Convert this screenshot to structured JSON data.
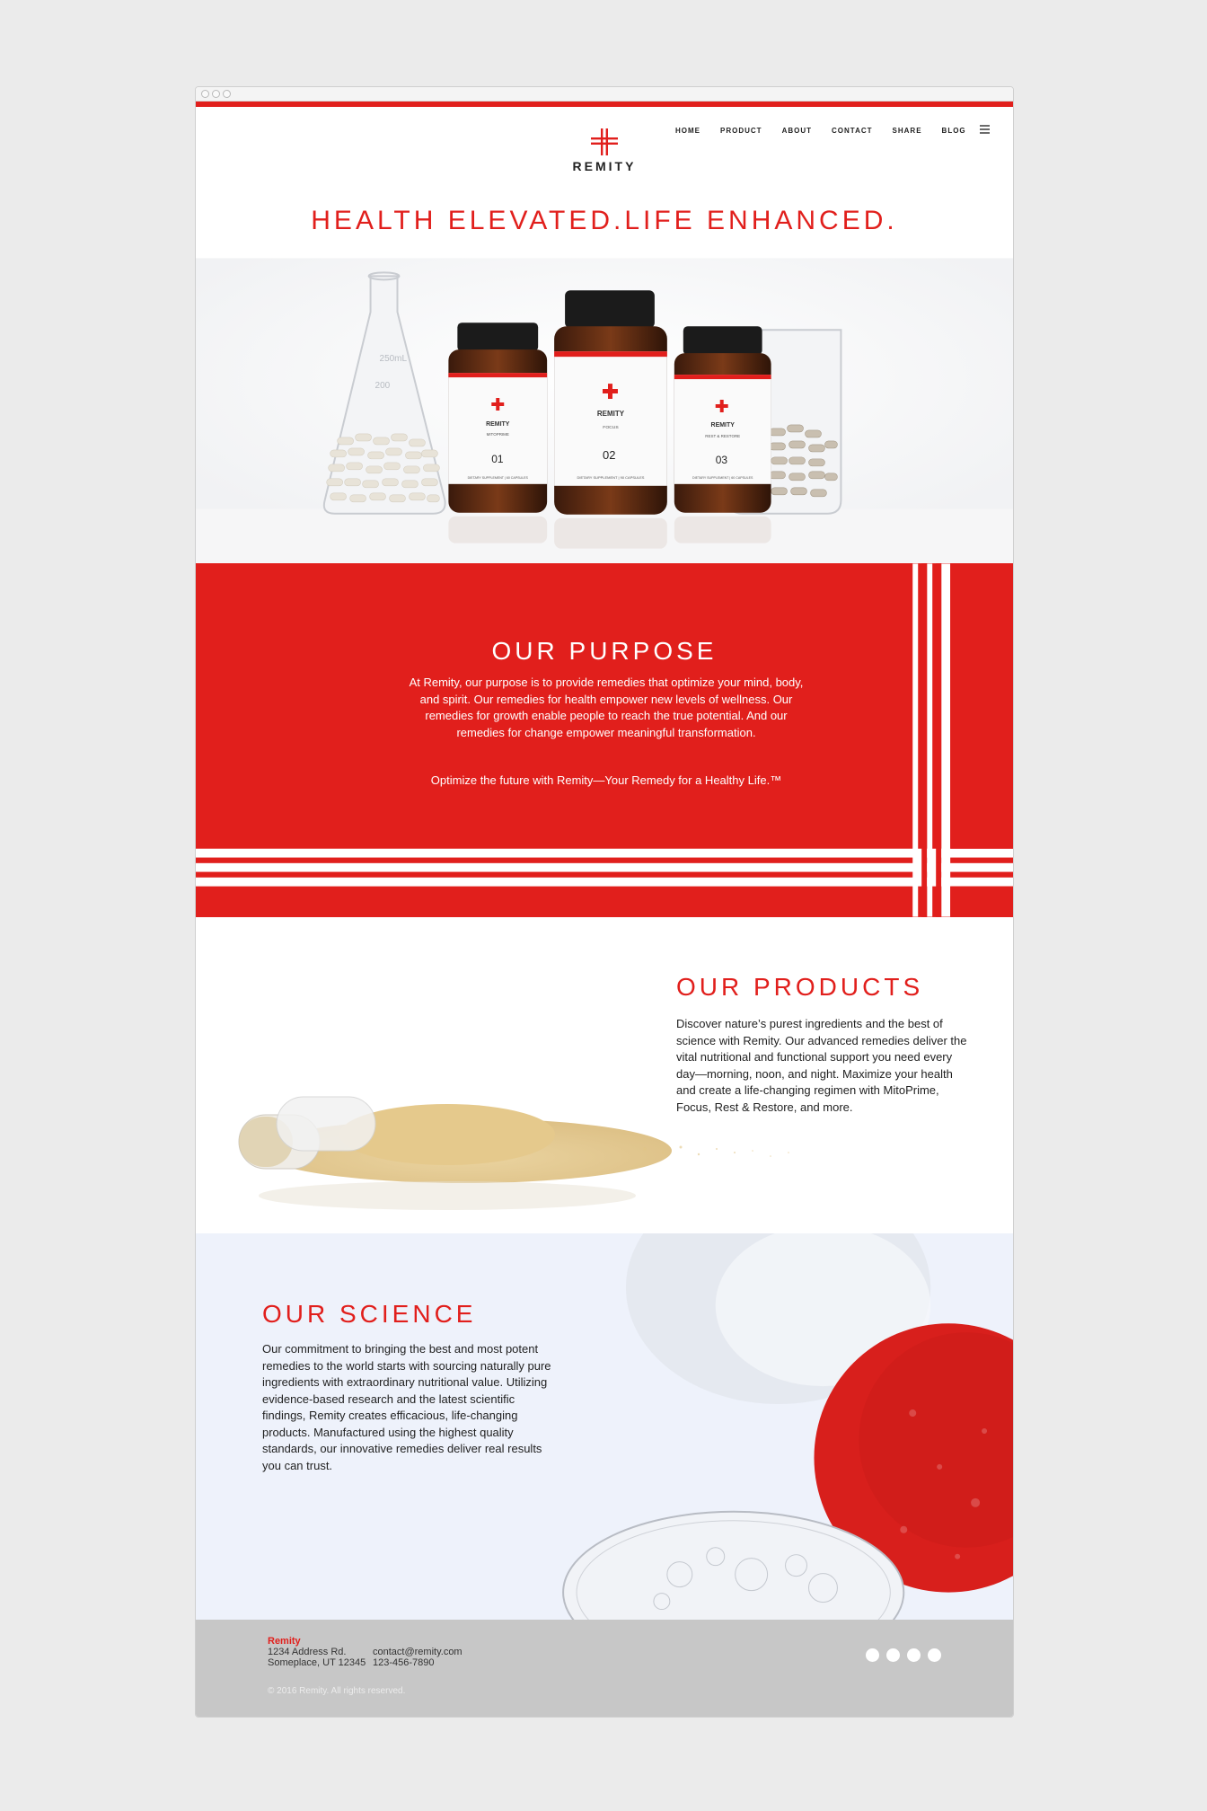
{
  "brand": {
    "name": "REMITY",
    "accent_color": "#e11f1c"
  },
  "nav": {
    "items": [
      "HOME",
      "PRODUCT",
      "ABOUT",
      "CONTACT",
      "SHARE",
      "BLOG"
    ],
    "menu_icon": "hamburger-icon"
  },
  "hero": {
    "title": "HEALTH ELEVATED.LIFE ENHANCED.",
    "bottles": [
      {
        "brand": "REMITY",
        "product": "MITOPRIME",
        "number": "01",
        "caption": "DIETARY SUPPLEMENT | 60 CAPSULES"
      },
      {
        "brand": "REMITY",
        "product": "FOCUS",
        "number": "02",
        "caption": "DIETARY SUPPLEMENT | 90 CAPSULES"
      },
      {
        "brand": "REMITY",
        "product": "REST & RESTORE",
        "number": "03",
        "caption": "DIETARY SUPPLEMENT | 60 CAPSULES"
      }
    ],
    "flask_marks": [
      "250mL",
      "200"
    ]
  },
  "purpose": {
    "title": "OUR PURPOSE",
    "body": "At Remity, our purpose is to provide remedies that optimize your mind, body, and spirit. Our remedies for health empower new levels of wellness. Our remedies for growth enable people to reach the true potential. And our remedies for change empower meaningful transformation.",
    "tagline": "Optimize the future with Remity—Your Remedy for a Healthy Life.™"
  },
  "products": {
    "title": "OUR PRODUCTS",
    "body": "Discover nature’s purest ingredients and the best of science with Remity. Our advanced remedies deliver the vital nutritional and functional support you need every day—morning, noon, and night. Maximize your health and create a life-changing regimen with MitoPrime, Focus, Rest & Restore, and more."
  },
  "science": {
    "title": "OUR SCIENCE",
    "body": "Our commitment to bringing the best and most potent remedies to the world starts with sourcing naturally pure ingredients with extraordinary nutritional value. Utilizing evidence-based research and the latest scientific findings, Remity creates efficacious, life-changing products. Manufactured using the highest quality standards, our innovative remedies deliver real results you can trust."
  },
  "footer": {
    "company": "Remity",
    "address_line1": "1234 Address Rd.",
    "address_line2": "Someplace, UT 12345",
    "email": "contact@remity.com",
    "phone": "123-456-7890",
    "copyright": "© 2016 Remity. All rights reserved.",
    "social_icons": [
      "social-icon-1",
      "social-icon-2",
      "social-icon-3",
      "social-icon-4"
    ]
  }
}
